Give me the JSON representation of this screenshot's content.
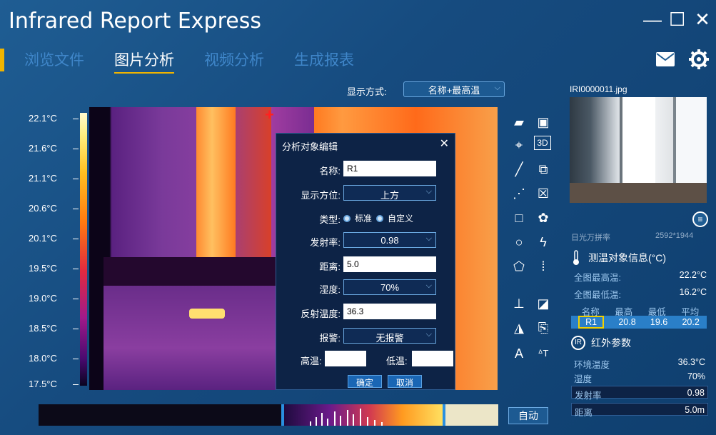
{
  "window": {
    "title": "Infrared Report Express",
    "controls": [
      "—",
      "☐",
      "✕"
    ]
  },
  "tabs": [
    {
      "label": "浏览文件",
      "active": false
    },
    {
      "label": "图片分析",
      "active": true
    },
    {
      "label": "视频分析",
      "active": false
    },
    {
      "label": "生成报表",
      "active": false
    }
  ],
  "header_icons": [
    "mail-icon",
    "gear-icon"
  ],
  "display": {
    "label": "显示方式:",
    "value": "名称+最高温"
  },
  "scale": {
    "ticks": [
      "22.1°C",
      "21.6°C",
      "21.1°C",
      "20.6°C",
      "20.1°C",
      "19.5°C",
      "19.0°C",
      "18.5°C",
      "18.0°C",
      "17.5°C"
    ]
  },
  "dialog": {
    "title": "分析对象编辑",
    "close": "✕",
    "fields": {
      "name": {
        "label": "名称:",
        "value": "R1"
      },
      "position": {
        "label": "显示方位:",
        "value": "上方"
      },
      "type": {
        "label": "类型:",
        "options": [
          "标准",
          "自定义"
        ]
      },
      "emissivity": {
        "label": "发射率:",
        "value": "0.98"
      },
      "distance": {
        "label": "距离:",
        "value": "5.0"
      },
      "humidity": {
        "label": "湿度:",
        "value": "70%"
      },
      "reflect_temp": {
        "label": "反射温度:",
        "value": "36.3"
      },
      "alarm": {
        "label": "报警:",
        "value": "无报警"
      },
      "high": {
        "label": "高温:"
      },
      "low": {
        "label": "低温:"
      }
    },
    "ok": "确定",
    "cancel": "取消"
  },
  "toolbar": {
    "text_tool": "A",
    "temp_text_tool": "ᐞT",
    "3d_label": "3D"
  },
  "right_panel": {
    "filename": "IRI0000011.jpg",
    "note_icon": "note-icon",
    "obscured_text": "日光万拼率",
    "obscured_value": "2592*1944",
    "measure_title": "测温对象信息(°C)",
    "global_max": {
      "label": "全图最高温:",
      "value": "22.2°C"
    },
    "global_min": {
      "label": "全图最低温:",
      "value": "16.2°C"
    },
    "roi_headers": [
      "名称",
      "最高",
      "最低",
      "平均"
    ],
    "roi_rows": [
      {
        "name": "R1",
        "max": "20.8",
        "min": "19.6",
        "avg": "20.2"
      }
    ],
    "ir_title": "红外参数",
    "ir_badge": "IR",
    "params": [
      {
        "label": "环境温度",
        "value": "36.3°C"
      },
      {
        "label": "湿度",
        "value": "70%"
      },
      {
        "label": "发射率",
        "value": "0.98"
      },
      {
        "label": "距离",
        "value": "5.0m"
      }
    ]
  },
  "auto_button": "自动"
}
